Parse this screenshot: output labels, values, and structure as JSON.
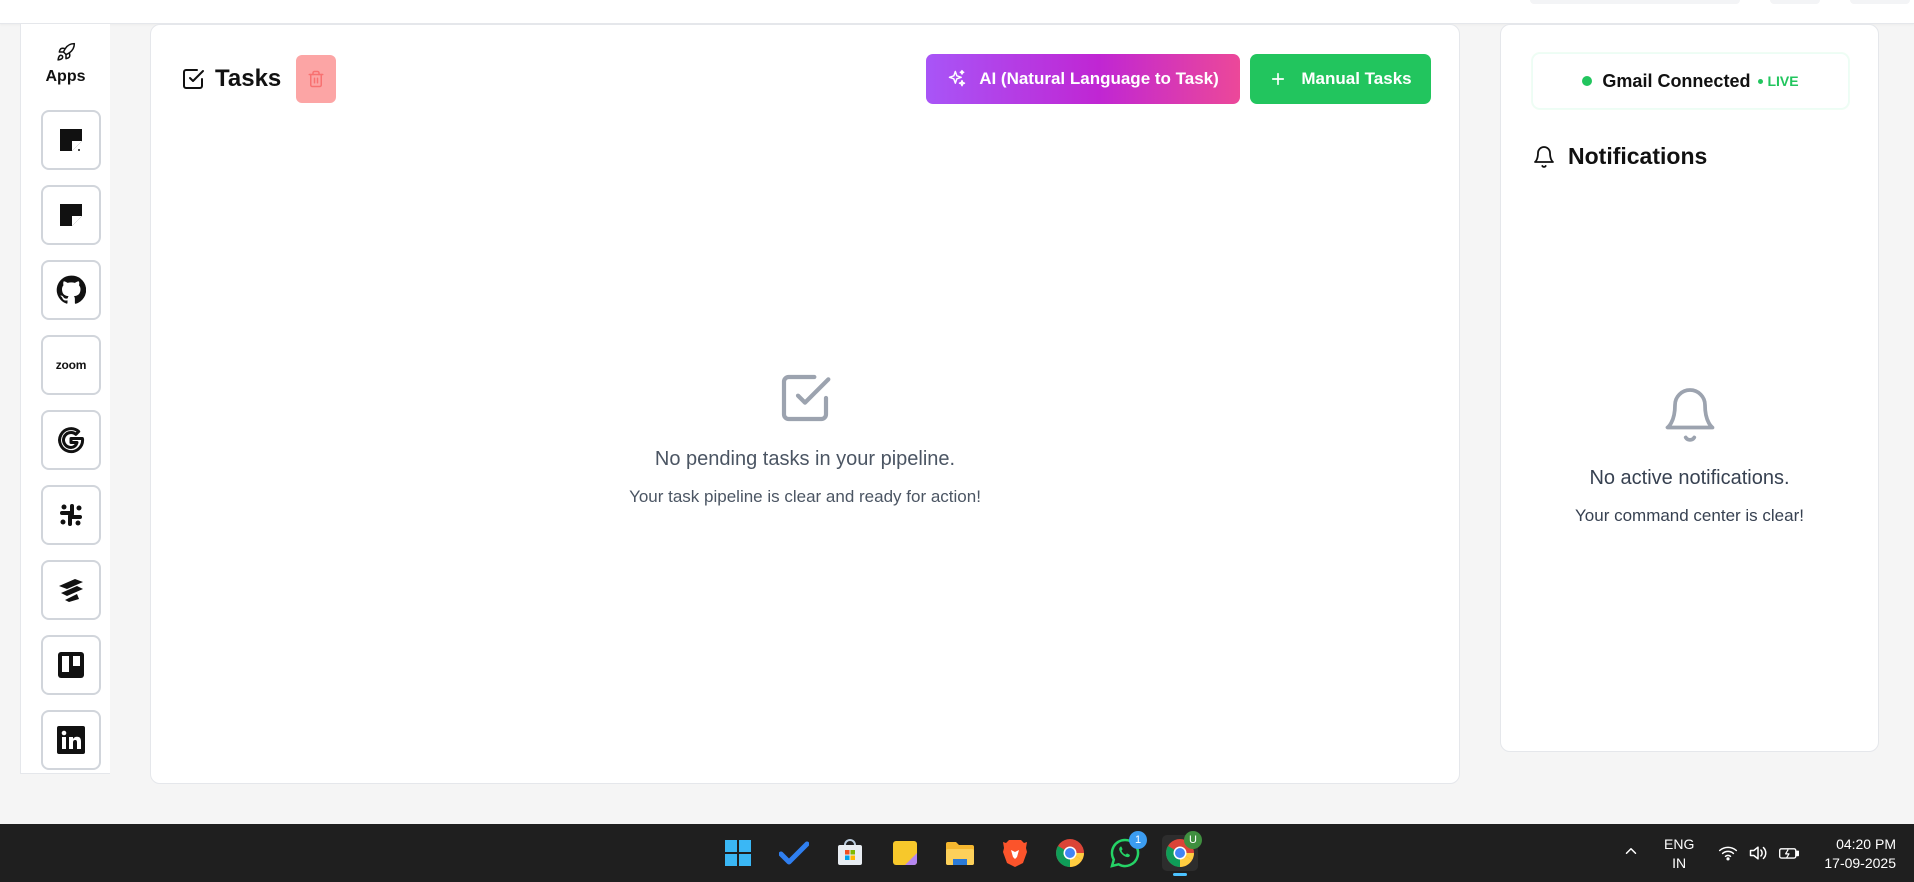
{
  "apps": {
    "heading": "Apps",
    "items": [
      {
        "name": "notion-1",
        "icon": "notion-icon"
      },
      {
        "name": "notion-2",
        "icon": "notion-icon"
      },
      {
        "name": "github",
        "icon": "github-icon"
      },
      {
        "name": "zoom",
        "icon": "zoom-icon",
        "label": "zoom"
      },
      {
        "name": "google",
        "icon": "google-icon"
      },
      {
        "name": "slack",
        "icon": "slack-icon"
      },
      {
        "name": "jira",
        "icon": "jira-icon"
      },
      {
        "name": "trello",
        "icon": "trello-icon"
      },
      {
        "name": "linkedin",
        "icon": "linkedin-icon"
      }
    ]
  },
  "tasks": {
    "title": "Tasks",
    "ai_button": "AI (Natural Language to Task)",
    "manual_button": "Manual Tasks",
    "empty_title": "No pending tasks in your pipeline.",
    "empty_subtitle": "Your task pipeline is clear and ready for action!"
  },
  "right_panel": {
    "gmail_status": "Gmail Connected",
    "live_label": "LIVE",
    "notifications_title": "Notifications",
    "empty_title": "No active notifications.",
    "empty_subtitle": "Your command center is clear!"
  },
  "taskbar": {
    "apps": [
      {
        "name": "start",
        "icon": "windows-start-icon"
      },
      {
        "name": "todo",
        "icon": "microsoft-todo-icon"
      },
      {
        "name": "store",
        "icon": "microsoft-store-icon"
      },
      {
        "name": "sticky-notes",
        "icon": "sticky-notes-icon"
      },
      {
        "name": "file-explorer",
        "icon": "folder-icon"
      },
      {
        "name": "brave",
        "icon": "brave-icon"
      },
      {
        "name": "chrome",
        "icon": "chrome-icon"
      },
      {
        "name": "whatsapp",
        "icon": "whatsapp-icon",
        "badge": "1"
      },
      {
        "name": "chrome-profile",
        "icon": "chrome-icon",
        "badge": "U",
        "active": true
      }
    ],
    "language_line1": "ENG",
    "language_line2": "IN",
    "time": "04:20 PM",
    "date": "17-09-2025"
  },
  "colors": {
    "success": "#22c55e",
    "danger_light": "#fca5a5",
    "ai_gradient_start": "#a855f7",
    "ai_gradient_end": "#ec4899",
    "taskbar": "#1f1f1f"
  }
}
